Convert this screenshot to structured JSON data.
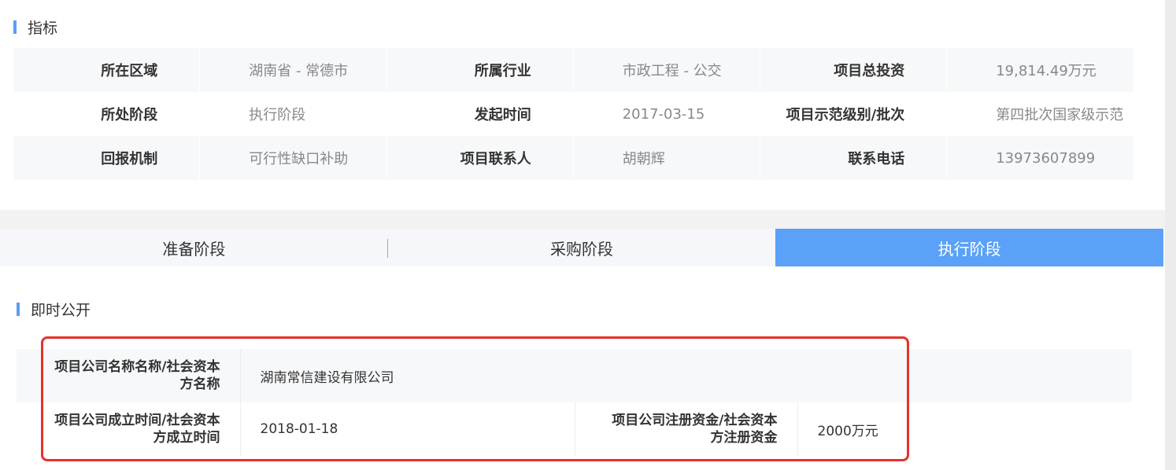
{
  "indicators": {
    "title": "指标",
    "rows": [
      [
        {
          "label": "所在区域",
          "value": "湖南省 - 常德市"
        },
        {
          "label": "所属行业",
          "value": "市政工程 - 公交"
        },
        {
          "label": "项目总投资",
          "value": "19,814.49万元"
        }
      ],
      [
        {
          "label": "所处阶段",
          "value": "执行阶段"
        },
        {
          "label": "发起时间",
          "value": "2017-03-15"
        },
        {
          "label": "项目示范级别/批次",
          "value": "第四批次国家级示范"
        }
      ],
      [
        {
          "label": "回报机制",
          "value": "可行性缺口补助"
        },
        {
          "label": "项目联系人",
          "value": "胡朝辉"
        },
        {
          "label": "联系电话",
          "value": "13973607899"
        }
      ]
    ]
  },
  "tabs": [
    {
      "label": "准备阶段",
      "active": false
    },
    {
      "label": "采购阶段",
      "active": false
    },
    {
      "label": "执行阶段",
      "active": true
    }
  ],
  "disclosure": {
    "title": "即时公开",
    "company_name_label_line1": "项目公司名称名称/社会资本",
    "company_name_label_line2": "方名称",
    "company_name_value": "湖南常信建设有限公司",
    "established_label_line1": "项目公司成立时间/社会资本",
    "established_label_line2": "方成立时间",
    "established_value": "2018-01-18",
    "capital_label_line1": "项目公司注册资金/社会资本",
    "capital_label_line2": "方注册资金",
    "capital_value": "2000万元"
  },
  "colors": {
    "accent": "#5aa1f7",
    "highlight_border": "#e8302a"
  }
}
